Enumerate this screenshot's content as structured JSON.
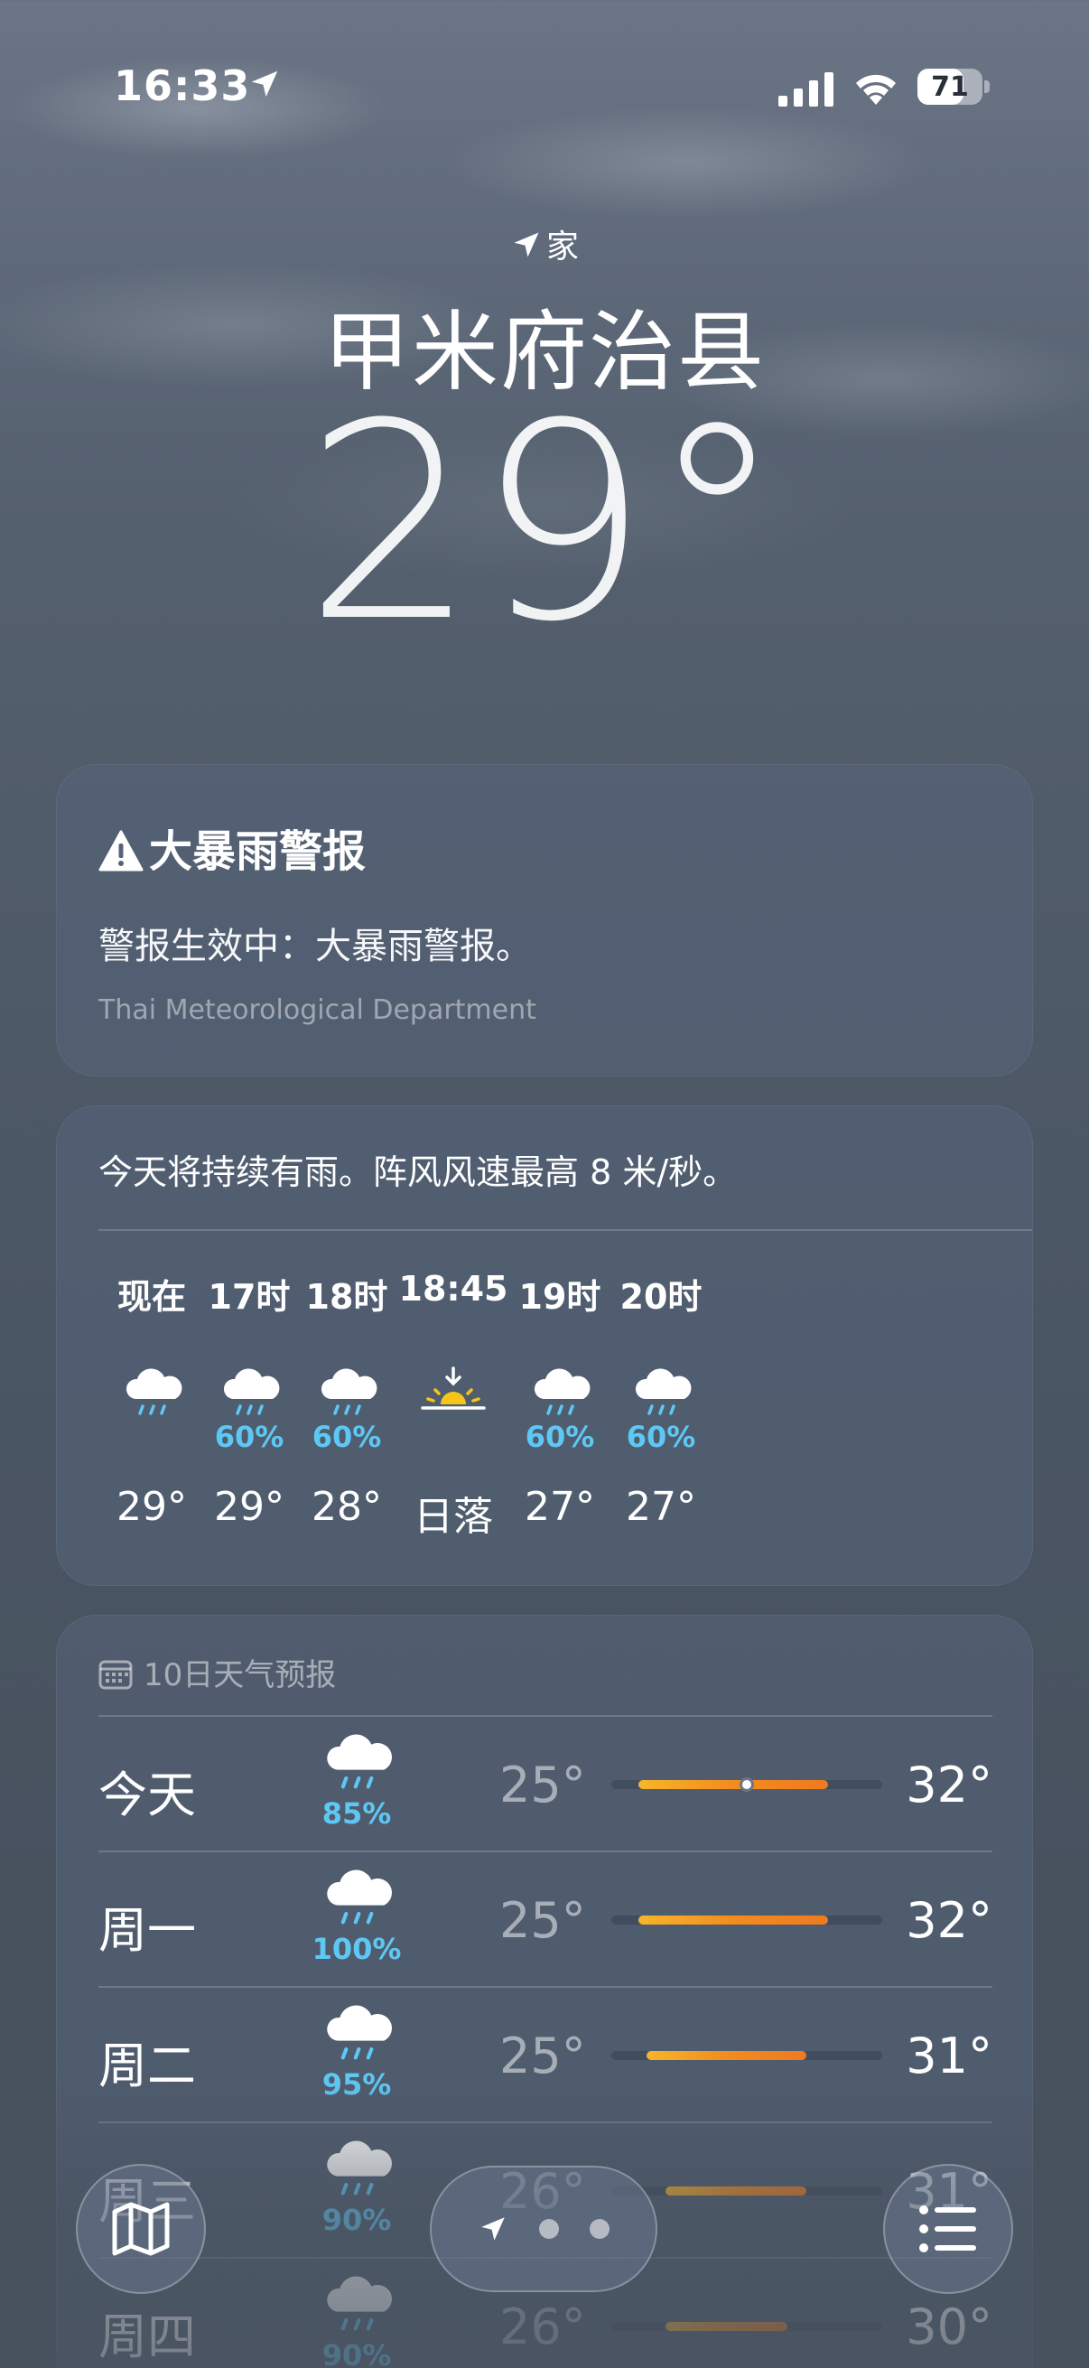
{
  "status_bar": {
    "time": "16:33",
    "battery": "71",
    "battery_level": 0.71
  },
  "location": {
    "label": "家",
    "city": "甲米府治县",
    "temperature": "29°"
  },
  "alert": {
    "title": "大暴雨警报",
    "text": "警报生效中：大暴雨警报。",
    "source": "Thai Meteorological Department",
    "icon": "warning-triangle-icon"
  },
  "hourly": {
    "summary": "今天将持续有雨。阵风风速最高 8 米/秒。",
    "items": [
      {
        "label": "现在",
        "icon": "cloud-rain-icon",
        "chance": "",
        "value": "29°"
      },
      {
        "label": "17时",
        "icon": "cloud-rain-icon",
        "chance": "60%",
        "value": "29°"
      },
      {
        "label": "18时",
        "icon": "cloud-rain-icon",
        "chance": "60%",
        "value": "28°"
      },
      {
        "label": "18:45",
        "icon": "sunset-icon",
        "chance": "",
        "value": "日落"
      },
      {
        "label": "19时",
        "icon": "cloud-moon-rain-icon",
        "chance": "60%",
        "value": "27°"
      },
      {
        "label": "20时",
        "icon": "cloud-moon-rain-icon",
        "chance": "60%",
        "value": "27°"
      }
    ]
  },
  "daily": {
    "header": "10日天气预报",
    "range_min": 24,
    "range_max": 34,
    "days": [
      {
        "name": "今天",
        "chance": "85%",
        "low": "25°",
        "high": "32°",
        "lo_val": 25,
        "hi_val": 32,
        "current_val": 29
      },
      {
        "name": "周一",
        "chance": "100%",
        "low": "25°",
        "high": "32°",
        "lo_val": 25,
        "hi_val": 32
      },
      {
        "name": "周二",
        "chance": "95%",
        "low": "25°",
        "high": "31°",
        "lo_val": 25.3,
        "hi_val": 31.2
      },
      {
        "name": "周三",
        "chance": "90%",
        "low": "26°",
        "high": "31°",
        "lo_val": 26,
        "hi_val": 31.2
      },
      {
        "name": "周四",
        "chance": "90%",
        "low": "26°",
        "high": "30°",
        "lo_val": 26,
        "hi_val": 30.5
      }
    ]
  },
  "toolbar": {
    "map_icon": "map-icon",
    "list_icon": "list-icon",
    "pager_icon": "location-arrow-icon"
  },
  "colors": {
    "precip": "#5ec8f5",
    "bar_start": "#f7b52a",
    "bar_end": "#ef7a20",
    "sun": "#f7c51a"
  }
}
